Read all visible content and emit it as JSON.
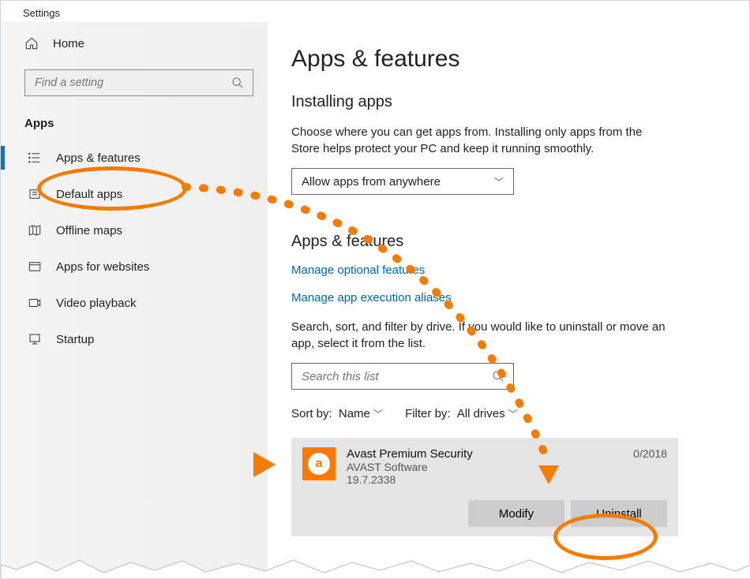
{
  "window": {
    "title": "Settings"
  },
  "sidebar": {
    "home": "Home",
    "search_placeholder": "Find a setting",
    "section": "Apps",
    "items": [
      {
        "label": "Apps & features",
        "active": true
      },
      {
        "label": "Default apps"
      },
      {
        "label": "Offline maps"
      },
      {
        "label": "Apps for websites"
      },
      {
        "label": "Video playback"
      },
      {
        "label": "Startup"
      }
    ]
  },
  "main": {
    "title": "Apps & features",
    "install_head": "Installing apps",
    "install_desc": "Choose where you can get apps from. Installing only apps from the Store helps protect your PC and keep it running smoothly.",
    "dropdown_value": "Allow apps from anywhere",
    "section2": "Apps & features",
    "link1": "Manage optional features",
    "link2": "Manage app execution aliases",
    "list_desc": "Search, sort, and filter by drive. If you would like to uninstall or move an app, select it from the list.",
    "list_search_placeholder": "Search this list",
    "sort_label": "Sort by:",
    "sort_value": "Name",
    "filter_label": "Filter by:",
    "filter_value": "All drives",
    "app": {
      "name": "Avast Premium Security",
      "publisher": "AVAST Software",
      "version": "19.7.2338",
      "date_partial": "0/2018",
      "modify": "Modify",
      "uninstall": "Uninstall"
    }
  }
}
